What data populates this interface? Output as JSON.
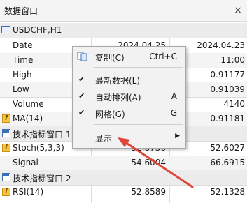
{
  "window": {
    "title": "数据窗口",
    "close_label": "×"
  },
  "header": {
    "symbol": "USDCHF,H1"
  },
  "rows": [
    {
      "name": "Date",
      "v1": "2024.04.25",
      "v2": "2024.04.23"
    },
    {
      "name": "Time",
      "v1": "",
      "v2": "11:00"
    },
    {
      "name": "High",
      "v1": "",
      "v2": "0.91177"
    },
    {
      "name": "Low",
      "v1": "",
      "v2": "0.91039"
    },
    {
      "name": "Volume",
      "v1": "",
      "v2": "4140"
    },
    {
      "name": "MA(14)",
      "v1": "",
      "v2": "0.91181"
    },
    {
      "name": "技术指标窗口 1",
      "v1": "",
      "v2": ""
    },
    {
      "name": "Stoch(5,3,3)",
      "v1": "52.8736",
      "v2": "52.6027"
    },
    {
      "name": "Signal",
      "v1": "54.6004",
      "v2": "66.6915"
    },
    {
      "name": "技术指标窗口 2",
      "v1": "",
      "v2": ""
    },
    {
      "name": "RSI(14)",
      "v1": "52.8589",
      "v2": "52.1328"
    }
  ],
  "context_menu": {
    "copy": {
      "label": "复制(C)",
      "shortcut": "Ctrl+C"
    },
    "latest": {
      "label": "最新数据(L)",
      "checked": true
    },
    "autoarrange": {
      "label": "自动排列(A)",
      "shortcut": "A",
      "checked": true
    },
    "grid": {
      "label": "网格(G)",
      "shortcut": "G",
      "checked": true
    },
    "show": {
      "label": "显示"
    }
  },
  "glyphs": {
    "check": "✔",
    "submenu": "▶"
  },
  "colors": {
    "annotation_arrow": "#e0453a",
    "icon_blue": "#3a6fb5",
    "icon_gold": "#f5c542"
  }
}
